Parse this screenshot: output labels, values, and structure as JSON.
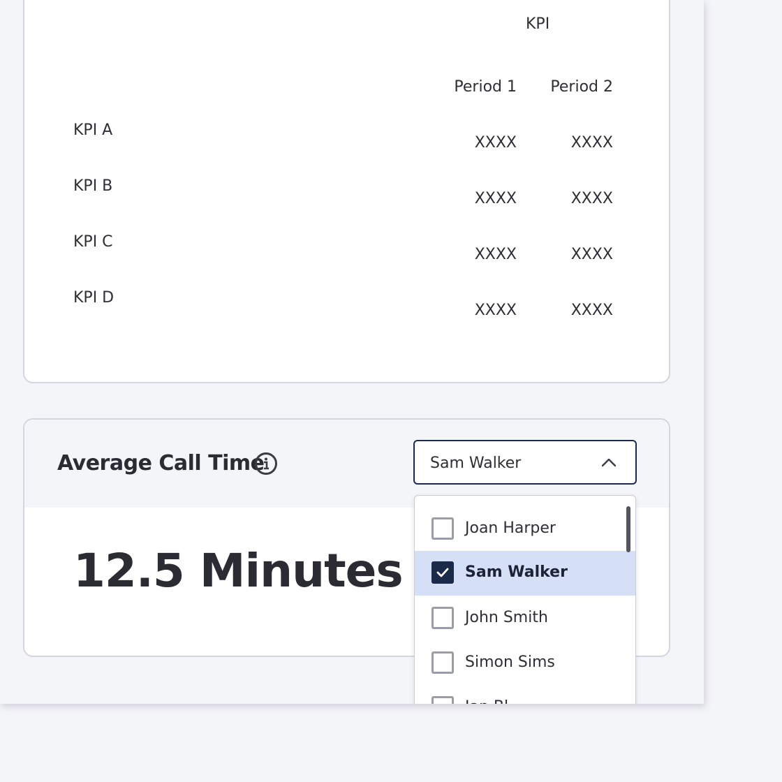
{
  "kpi_table": {
    "group_header": "KPI",
    "columns": [
      "Period 1",
      "Period 2"
    ],
    "rows": [
      {
        "label": "KPI A",
        "values": [
          "XXXX",
          "XXXX"
        ]
      },
      {
        "label": "KPI B",
        "values": [
          "XXXX",
          "XXXX"
        ]
      },
      {
        "label": "KPI C",
        "values": [
          "XXXX",
          "XXXX"
        ]
      },
      {
        "label": "KPI D",
        "values": [
          "XXXX",
          "XXXX"
        ]
      }
    ]
  },
  "average_call_time": {
    "title": "Average Call Time",
    "info_icon": "info-icon",
    "value": "12.5 Minutes"
  },
  "agent_select": {
    "selected": "Sam Walker",
    "icon": "chevron-up-icon",
    "options": [
      {
        "label": "Joan Harper",
        "checked": false
      },
      {
        "label": "Sam Walker",
        "checked": true
      },
      {
        "label": "John Smith",
        "checked": false
      },
      {
        "label": "Simon Sims",
        "checked": false
      },
      {
        "label": "Ian Bl",
        "checked": false
      }
    ]
  },
  "colors": {
    "accent": "#1c2a4a",
    "selected_option_bg": "#d5dff5",
    "card_border": "#d3d6e0",
    "page_bg": "#f4f5f9"
  }
}
